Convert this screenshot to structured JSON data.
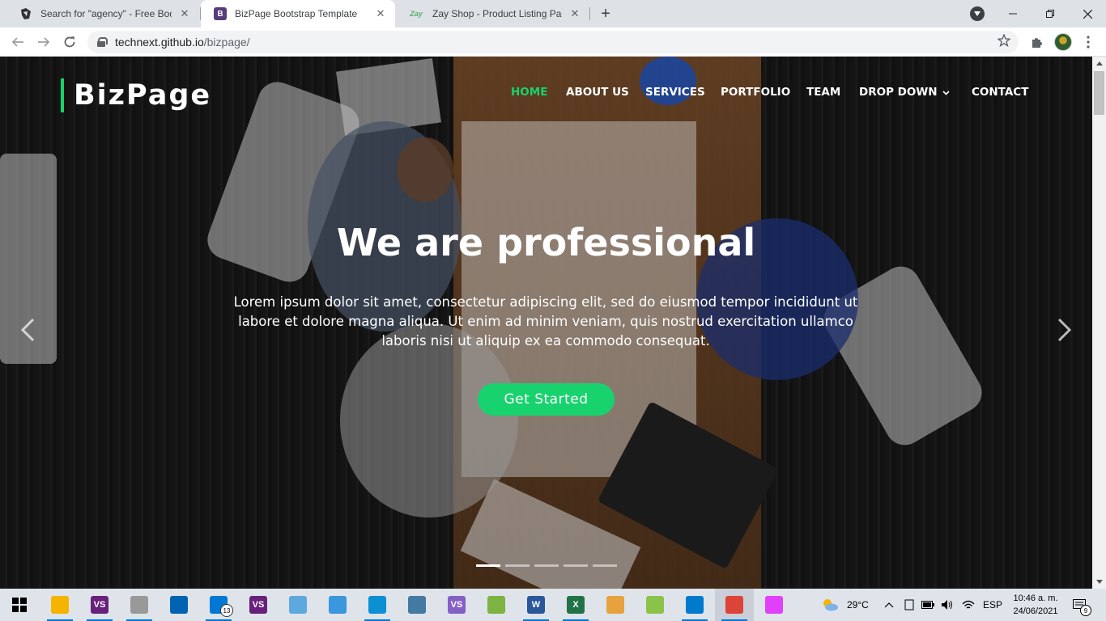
{
  "browser": {
    "tabs": [
      {
        "title": "Search for \"agency\" - Free Bootstrap",
        "favicon": "bootstrap-made-icon",
        "active": false
      },
      {
        "title": "BizPage Bootstrap Template",
        "favicon": "bootstrap-b-icon",
        "favicon_text": "B",
        "active": true
      },
      {
        "title": "Zay Shop - Product Listing Page",
        "favicon": "zay-icon",
        "favicon_text": "Zay",
        "active": false
      }
    ],
    "close_glyph": "✕",
    "new_tab_glyph": "+",
    "url_host": "technext.github.io",
    "url_path": "/bizpage/"
  },
  "site": {
    "logo": "BizPage",
    "accent_color": "#18d26e",
    "nav": [
      {
        "label": "HOME",
        "active": true
      },
      {
        "label": "ABOUT US",
        "active": false
      },
      {
        "label": "SERVICES",
        "active": false
      },
      {
        "label": "PORTFOLIO",
        "active": false
      },
      {
        "label": "TEAM",
        "active": false
      },
      {
        "label": "DROP DOWN",
        "active": false,
        "has_caret": true
      },
      {
        "label": "CONTACT",
        "active": false
      }
    ],
    "hero": {
      "title": "We are professional",
      "text": "Lorem ipsum dolor sit amet, consectetur adipiscing elit, sed do eiusmod tempor incididunt ut labore et dolore magna aliqua. Ut enim ad minim veniam, quis nostrud exercitation ullamco laboris nisi ut aliquip ex ea commodo consequat.",
      "cta": "Get Started",
      "prev_glyph": "‹",
      "next_glyph": "›",
      "slides_count": 5,
      "current_slide": 1
    }
  },
  "taskbar": {
    "apps": [
      {
        "name": "file-explorer-icon",
        "color": "#f4b400"
      },
      {
        "name": "visual-studio-icon",
        "color": "#68217a",
        "text": "VS"
      },
      {
        "name": "tool-icon",
        "color": "#999999"
      },
      {
        "name": "app-icon",
        "color": "#0063b1"
      },
      {
        "name": "mail-icon",
        "color": "#0078d4",
        "badge": "13"
      },
      {
        "name": "visual-studio-icon-2",
        "color": "#68217a",
        "text": "VS"
      },
      {
        "name": "media-icon",
        "color": "#5da9dd"
      },
      {
        "name": "azure-data-studio-icon",
        "color": "#3a96dd"
      },
      {
        "name": "edge-icon",
        "color": "#0c8fd3"
      },
      {
        "name": "mysql-workbench-icon",
        "color": "#4479a1"
      },
      {
        "name": "visual-studio-icon-3",
        "color": "#865fc5",
        "text": "VS"
      },
      {
        "name": "git-icon",
        "color": "#7cb342"
      },
      {
        "name": "word-icon",
        "color": "#2b579a",
        "text": "W"
      },
      {
        "name": "excel-icon",
        "color": "#217346",
        "text": "X"
      },
      {
        "name": "paint-icon",
        "color": "#e6a23c"
      },
      {
        "name": "paint-icon-2",
        "color": "#8bc34a"
      },
      {
        "name": "vscode-icon",
        "color": "#007acc"
      },
      {
        "name": "chrome-icon",
        "color": "#db4437"
      },
      {
        "name": "app-drop-icon",
        "color": "#e040fb"
      }
    ],
    "weather": "29°C",
    "language": "ESP",
    "time": "10:46 a. m.",
    "date": "24/06/2021",
    "notifications": "9"
  }
}
